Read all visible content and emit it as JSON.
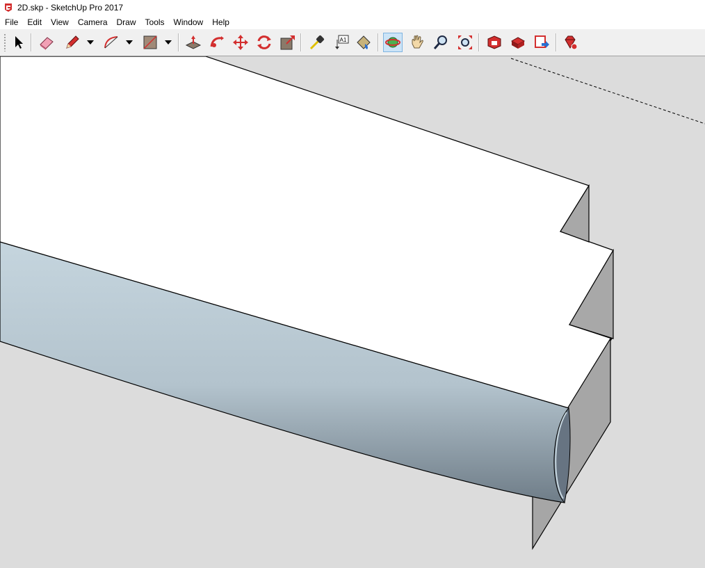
{
  "window": {
    "title": "2D.skp - SketchUp Pro 2017"
  },
  "menu": {
    "items": [
      {
        "id": "file",
        "label": "File"
      },
      {
        "id": "edit",
        "label": "Edit"
      },
      {
        "id": "view",
        "label": "View"
      },
      {
        "id": "camera",
        "label": "Camera"
      },
      {
        "id": "draw",
        "label": "Draw"
      },
      {
        "id": "tools",
        "label": "Tools"
      },
      {
        "id": "window",
        "label": "Window"
      },
      {
        "id": "help",
        "label": "Help"
      }
    ]
  },
  "toolbar": {
    "tools": [
      {
        "name": "select-tool",
        "icon": "arrow-cursor-icon"
      },
      {
        "name": "eraser-tool",
        "icon": "eraser-icon"
      },
      {
        "name": "pencil-tool",
        "icon": "pencil-icon"
      },
      {
        "name": "arc-tool",
        "icon": "arc-icon"
      },
      {
        "name": "rectangle-tool",
        "icon": "rectangle-icon"
      },
      {
        "name": "push-pull-tool",
        "icon": "push-pull-icon"
      },
      {
        "name": "follow-me-tool",
        "icon": "follow-me-icon"
      },
      {
        "name": "move-tool",
        "icon": "move-icon"
      },
      {
        "name": "rotate-tool",
        "icon": "rotate-icon"
      },
      {
        "name": "scale-tool",
        "icon": "scale-icon"
      },
      {
        "name": "tape-measure-tool",
        "icon": "tape-measure-icon"
      },
      {
        "name": "text-tool",
        "icon": "text-label-icon",
        "label": "A1"
      },
      {
        "name": "paint-bucket-tool",
        "icon": "paint-bucket-icon"
      },
      {
        "name": "orbit-tool",
        "icon": "orbit-icon",
        "active": true
      },
      {
        "name": "pan-tool",
        "icon": "hand-icon"
      },
      {
        "name": "zoom-tool",
        "icon": "magnifier-icon"
      },
      {
        "name": "zoom-extents-tool",
        "icon": "zoom-extents-icon"
      },
      {
        "name": "warehouse-tool",
        "icon": "3d-warehouse-icon"
      },
      {
        "name": "share-model-tool",
        "icon": "share-model-icon"
      },
      {
        "name": "send-to-layout-tool",
        "icon": "send-to-layout-icon"
      },
      {
        "name": "extension-warehouse-tool",
        "icon": "ruby-gem-icon"
      }
    ]
  },
  "colors": {
    "background": "#dcdcdc",
    "face_white": "#ffffff",
    "face_gray": "#a6a6a6",
    "pipe_light": "#c5d5de",
    "pipe_dark": "#6f7d88",
    "edge": "#000000",
    "accent_red": "#c8102e"
  }
}
